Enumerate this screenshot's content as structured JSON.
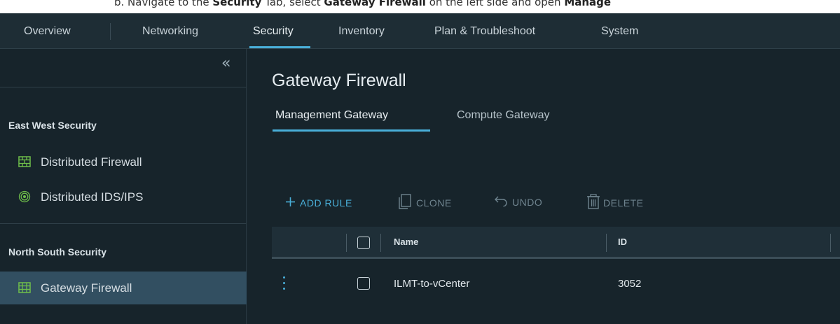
{
  "instruction": {
    "prefix": "b.  Navigate to the ",
    "b1": "Security",
    "mid1": " Tab, select ",
    "b2": "Gateway Firewall",
    "mid2": " on the left side and open ",
    "b3": "Manage"
  },
  "nav": {
    "items": [
      "Overview",
      "Networking",
      "Security",
      "Inventory",
      "Plan & Troubleshoot",
      "System"
    ],
    "active": "Security"
  },
  "sidebar": {
    "collapse_glyph": "«",
    "sections": [
      {
        "heading": "East West Security",
        "items": [
          {
            "label": "Distributed Firewall",
            "icon": "firewall-icon"
          },
          {
            "label": "Distributed IDS/IPS",
            "icon": "ids-ips-icon"
          }
        ]
      },
      {
        "heading": "North South Security",
        "items": [
          {
            "label": "Gateway Firewall",
            "icon": "gateway-firewall-icon",
            "active": true
          }
        ]
      }
    ]
  },
  "main": {
    "title": "Gateway Firewall",
    "tabs": [
      "Management Gateway",
      "Compute Gateway"
    ],
    "active_tab": "Management Gateway",
    "toolbar": {
      "add_rule": "ADD RULE",
      "clone": "CLONE",
      "undo": "UNDO",
      "delete": "DELETE"
    },
    "table": {
      "columns": [
        "Name",
        "ID"
      ],
      "rows": [
        {
          "name": "ILMT-to-vCenter",
          "id": "3052"
        }
      ]
    }
  },
  "colors": {
    "accent": "#49afd9",
    "nav_bg": "#1e2d35",
    "page_bg": "#17242b",
    "active_item_bg": "#324f61"
  }
}
